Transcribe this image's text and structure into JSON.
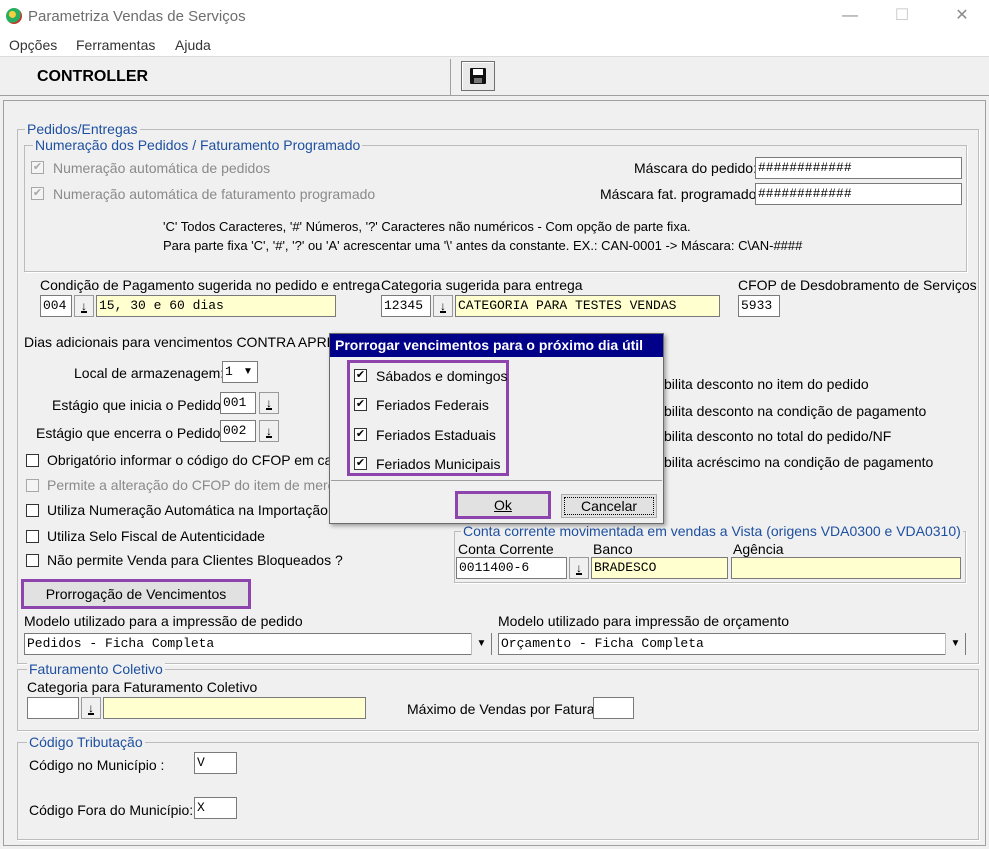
{
  "window": {
    "title": "Parametriza Vendas de Serviços",
    "minimize": "—",
    "maximize": "☐",
    "close": "✕"
  },
  "menu": [
    "Opções",
    "Ferramentas",
    "Ajuda"
  ],
  "toolbar": {
    "title": "CONTROLLER"
  },
  "pedidos": {
    "legend": "Pedidos/Entregas",
    "numeracao": {
      "legend": "Numeração dos Pedidos / Faturamento Programado",
      "auto_pedidos": "Numeração automática de pedidos",
      "auto_fat": "Numeração automática de faturamento programado",
      "mascara_pedido_label": "Máscara do pedido:",
      "mascara_pedido_value": "############",
      "mascara_fat_label": "Máscara fat. programado:",
      "mascara_fat_value": "############",
      "help1": "'C'  Todos Caracteres,   '#'  Números,   '?'  Caracteres não numéricos  - Com opção de parte fixa.",
      "help2": "Para parte fixa 'C', '#', '?' ou 'A'  acrescentar uma '\\' antes da constante. EX.:  CAN-0001 -> Máscara: C\\AN-####"
    },
    "cond_pag_label": "Condição de Pagamento sugerida no pedido e entrega",
    "cond_pag_code": "004",
    "cond_pag_desc": "15, 30 e 60 dias",
    "categoria_label": "Categoria sugerida para entrega",
    "categoria_code": "12345",
    "categoria_desc": "CATEGORIA PARA TESTES VENDAS",
    "cfop_label": "CFOP de Desdobramento de Serviços",
    "cfop_value": "5933",
    "dias_label": "Dias adicionais para vencimentos CONTRA APRES",
    "local_label": "Local de armazenagem:",
    "local_value": "1",
    "estagio_ini_label": "Estágio que inicia o Pedido:",
    "estagio_ini_value": "001",
    "estagio_fim_label": "Estágio que encerra o Pedido:",
    "estagio_fim_value": "002",
    "chk_cfop": "Obrigatório informar o código do CFOP em cada",
    "chk_alt_cfop": "Permite a alteração do CFOP do item de mercad",
    "chk_num_auto": "Utiliza Numeração Automática na Importação d",
    "chk_selo": "Utiliza Selo Fiscal de Autenticidade",
    "chk_bloq": "Não permite Venda para Clientes Bloqueados ?",
    "right_chk1": "bilita desconto no item do pedido",
    "right_chk2": "bilita desconto na condição de pagamento",
    "right_chk3": "bilita desconto no total do pedido/NF",
    "right_chk4": "bilita acréscimo na condição de pagamento",
    "conta": {
      "legend": "Conta corrente movimentada em vendas a Vista (origens VDA0300 e VDA0310)",
      "conta_label": "Conta Corrente",
      "conta_value": "0011400-6",
      "banco_label": "Banco",
      "banco_value": "BRADESCO",
      "agencia_label": "Agência",
      "agencia_value": ""
    },
    "prorrogacao_button": "Prorrogação de Vencimentos",
    "modelo_pedido_label": "Modelo utilizado para a impressão de pedido",
    "modelo_pedido_value": "Pedidos - Ficha Completa",
    "modelo_orc_label": "Modelo utilizado para impressão de orçamento",
    "modelo_orc_value": "Orçamento - Ficha Completa"
  },
  "coletivo": {
    "legend": "Faturamento Coletivo",
    "categoria_label": "Categoria para Faturamento Coletivo",
    "categoria_code": "",
    "categoria_desc": "",
    "max_label": "Máximo de Vendas por Fatura:",
    "max_value": ""
  },
  "tributacao": {
    "legend": "Código Tributação",
    "municipio_label": "Código no Município :",
    "municipio_value": "V",
    "fora_label": "Código Fora do Município:",
    "fora_value": "X"
  },
  "dialog": {
    "title": "Prorrogar vencimentos para o próximo dia útil",
    "items": [
      "Sábados e domingos",
      "Feriados Federais",
      "Feriados Estaduais",
      "Feriados Municipais"
    ],
    "ok": "Ok",
    "cancel": "Cancelar"
  },
  "colors": {
    "highlight": "#8e44ad",
    "legend": "#1e50a0",
    "dialog_title": "#000088",
    "yellow_field": "#ffffd0"
  }
}
